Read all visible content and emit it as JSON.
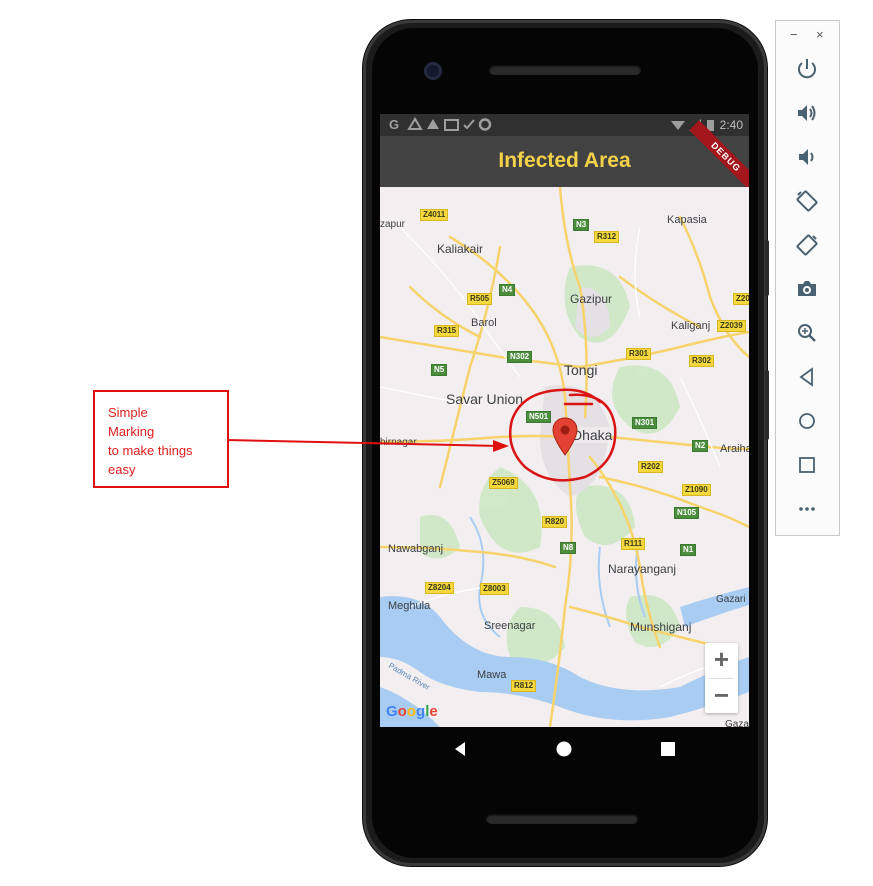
{
  "app": {
    "title": "Infected Area",
    "debug_banner": "DEBUG",
    "status_time": "2:40"
  },
  "map": {
    "places": [
      {
        "name": "Kaliakair"
      },
      {
        "name": "Kapasia"
      },
      {
        "name": "Gazipur"
      },
      {
        "name": "Barol"
      },
      {
        "name": "Kaliganj"
      },
      {
        "name": "Tongi"
      },
      {
        "name": "Savar Union"
      },
      {
        "name": "Dhaka"
      },
      {
        "name": "Araiha"
      },
      {
        "name": "Nawabganj"
      },
      {
        "name": "Narayanganj"
      },
      {
        "name": "Meghula"
      },
      {
        "name": "Sreenagar"
      },
      {
        "name": "Munshiganj"
      },
      {
        "name": "Mawa"
      },
      {
        "name": "Gazari"
      },
      {
        "name": "Gazar"
      },
      {
        "name": "zapur"
      },
      {
        "name": "hirnagar"
      },
      {
        "name": "Padma River"
      }
    ],
    "road_shields": [
      "Z4011",
      "N3",
      "R312",
      "N4",
      "R505",
      "R315",
      "Z20",
      "Z2039",
      "N302",
      "R301",
      "R302",
      "N5",
      "N501",
      "N301",
      "N2",
      "R202",
      "Z5069",
      "Z1090",
      "N105",
      "R820",
      "N8",
      "R111",
      "N1",
      "Z8204",
      "Z8003",
      "R812"
    ],
    "zoom_in": "+",
    "zoom_out": "−",
    "attribution": "Google",
    "marker": "location-pin"
  },
  "annotation": {
    "text": "Simple\nMarking\nto make things\neasy",
    "color": "#e01010"
  },
  "emulator": {
    "minimize": "−",
    "close": "×"
  },
  "colors": {
    "app_title": "#f3d24a",
    "appbar": "#424242",
    "marker": "#d93025",
    "annotation": "#e01010"
  }
}
